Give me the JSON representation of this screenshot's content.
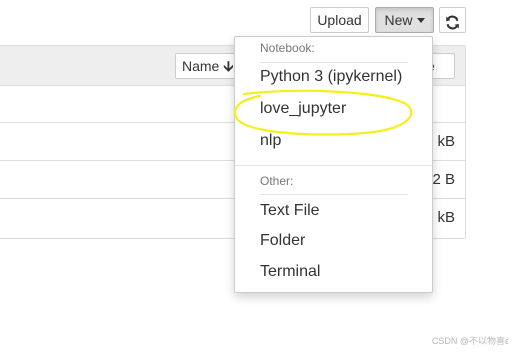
{
  "toolbar": {
    "upload_label": "Upload",
    "new_label": "New",
    "refresh_icon": "refresh-icon"
  },
  "list_header": {
    "sort_name_label": "Name",
    "sort_name_arrow": "🡫",
    "sort_size_partial": "ze"
  },
  "rows": [
    {
      "size": "kB"
    },
    {
      "size": "2 B"
    },
    {
      "size": "kB"
    }
  ],
  "new_menu": {
    "notebook_header": "Notebook:",
    "notebook_items": [
      "Python 3 (ipykernel)",
      "love_jupyter",
      "nlp"
    ],
    "other_header": "Other:",
    "other_items": [
      "Text File",
      "Folder",
      "Terminal"
    ]
  },
  "annotation": {
    "highlight_color": "#f5ef1a"
  },
  "watermark": "CSDN @不以物喜ε"
}
